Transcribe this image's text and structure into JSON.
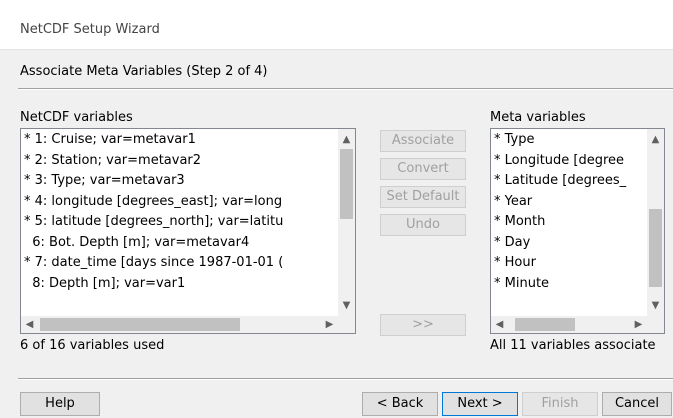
{
  "window": {
    "title": "NetCDF Setup Wizard"
  },
  "step_title": "Associate Meta Variables (Step 2 of 4)",
  "left_panel": {
    "label": "NetCDF variables",
    "items": [
      "* 1: Cruise; var=metavar1",
      "* 2: Station; var=metavar2",
      "* 3: Type; var=metavar3",
      "* 4: longitude [degrees_east]; var=long",
      "* 5: latitude [degrees_north]; var=latitu",
      "  6: Bot. Depth [m]; var=metavar4",
      "* 7: date_time [days since 1987-01-01 (",
      "  8: Depth [m]; var=var1"
    ],
    "status": "6 of 16 variables used"
  },
  "middle_buttons": {
    "associate": "Associate",
    "convert": "Convert",
    "set_default": "Set Default",
    "undo": "Undo",
    "move": ">>"
  },
  "right_panel": {
    "label": "Meta variables",
    "items": [
      "* Type",
      "* Longitude [degree",
      "* Latitude [degrees_",
      "* Year",
      "* Month",
      "* Day",
      "* Hour",
      "* Minute"
    ],
    "status": "All 11 variables associate"
  },
  "footer": {
    "help": "Help",
    "back": "< Back",
    "next": "Next >",
    "finish": "Finish",
    "cancel": "Cancel"
  },
  "icons": {
    "up": "chevron-up-icon",
    "down": "chevron-down-icon",
    "left": "chevron-left-icon",
    "right": "chevron-right-icon"
  }
}
